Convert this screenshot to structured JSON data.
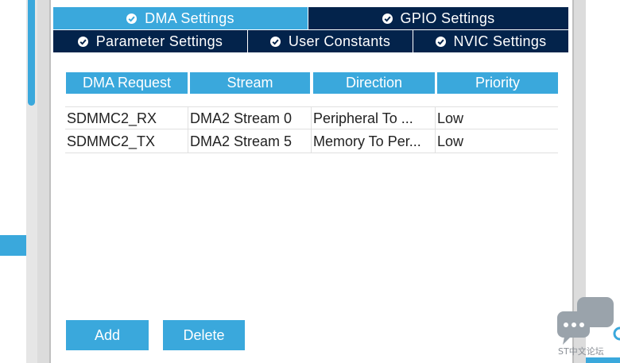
{
  "tabs": {
    "row1": [
      {
        "label": "DMA Settings",
        "active": true
      },
      {
        "label": "GPIO Settings",
        "active": false
      }
    ],
    "row2": [
      {
        "label": "Parameter Settings",
        "active": false
      },
      {
        "label": "User Constants",
        "active": false
      },
      {
        "label": "NVIC Settings",
        "active": false
      }
    ]
  },
  "table": {
    "headers": [
      "DMA Request",
      "Stream",
      "Direction",
      "Priority"
    ],
    "rows": [
      [
        "SDMMC2_RX",
        "DMA2 Stream 0",
        "Peripheral To ...",
        "Low"
      ],
      [
        "SDMMC2_TX",
        "DMA2 Stream 5",
        "Memory To Per...",
        "Low"
      ]
    ]
  },
  "buttons": {
    "add": "Add",
    "delete": "Delete"
  },
  "watermark": {
    "text": "ST中文论坛"
  },
  "colors": {
    "accent": "#3aa8dc",
    "tab_dark": "#03234b"
  }
}
